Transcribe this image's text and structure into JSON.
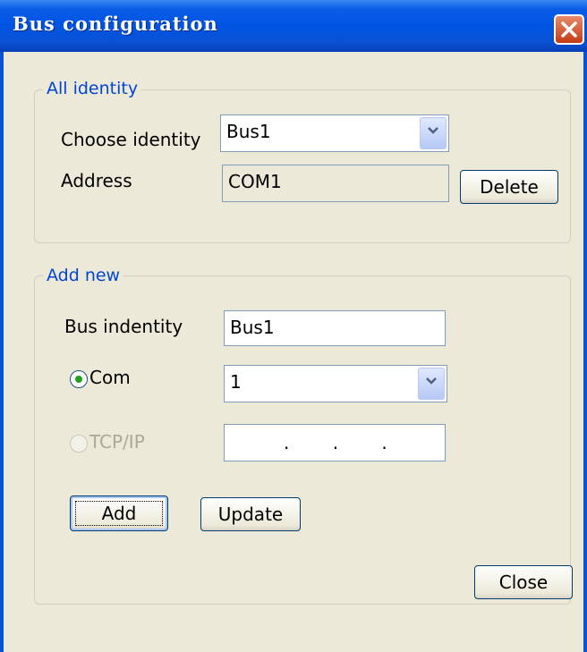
{
  "window": {
    "title": "Bus configuration"
  },
  "all_identity": {
    "legend": "All identity",
    "choose_label": "Choose identity",
    "choose_value": "Bus1",
    "address_label": "Address",
    "address_value": "COM1",
    "delete_label": "Delete"
  },
  "add_new": {
    "legend": "Add new",
    "bus_identity_label": "Bus indentity",
    "bus_identity_value": "Bus1",
    "com_label": "Com",
    "com_selected": true,
    "com_value": "1",
    "tcp_label": "TCP/IP",
    "tcp_selected": false,
    "ip_value": ". . .",
    "add_label": "Add",
    "update_label": "Update"
  },
  "close_label": "Close",
  "icons": [
    "close-icon",
    "dropdown-arrow-icon",
    "radio-icon"
  ],
  "colors": {
    "titlebar": "#0054e3",
    "legend": "#0046d5",
    "close_button": "#c43b16"
  }
}
